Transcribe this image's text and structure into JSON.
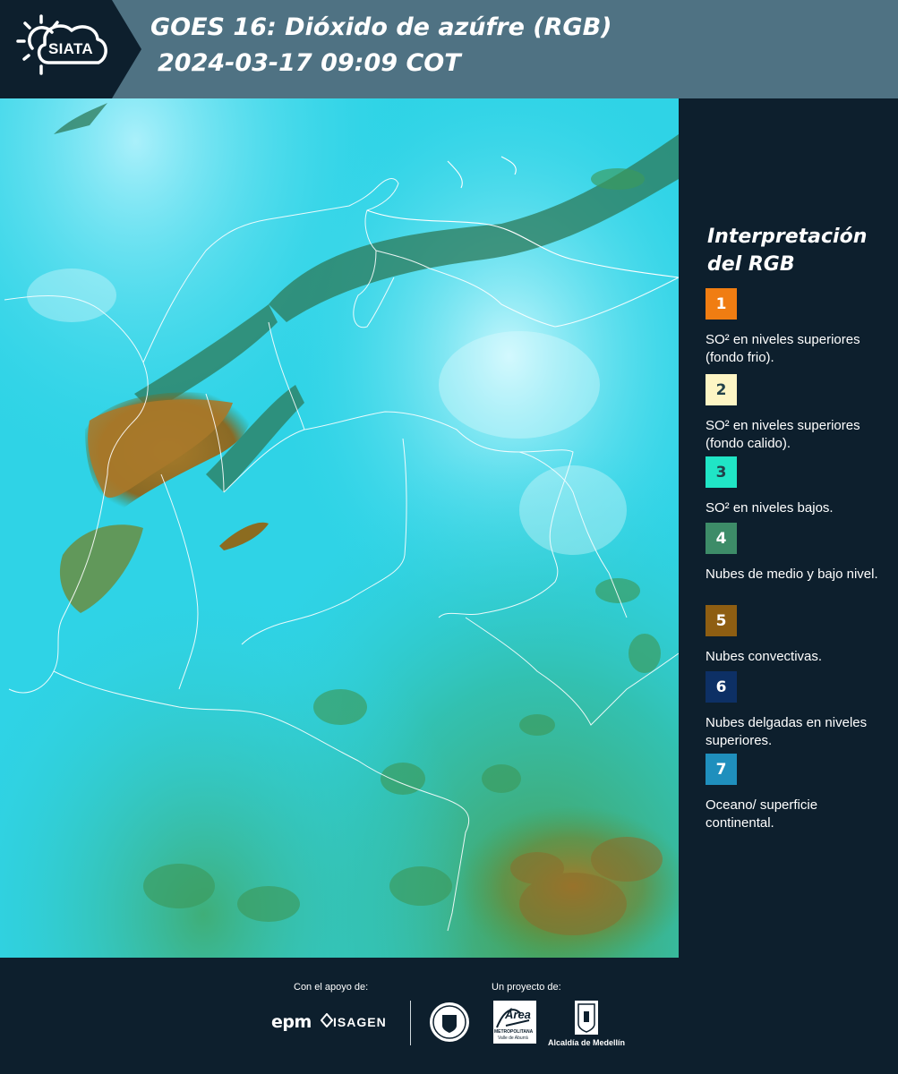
{
  "header": {
    "logo_text": "SIATA",
    "title_line1": "GOES 16: Dióxido de azúfre (RGB)",
    "title_line2": "2024-03-17 09:09 COT"
  },
  "legend": {
    "title": "Interpretación del RGB",
    "items": [
      {
        "number": "1",
        "color": "#f07d12",
        "description": "SO² en niveles superiores (fondo frio)."
      },
      {
        "number": "2",
        "color": "#fdf5c4",
        "description": "SO² en niveles superiores (fondo calido)."
      },
      {
        "number": "3",
        "color": "#20e5c6",
        "description": "SO² en niveles bajos."
      },
      {
        "number": "4",
        "color": "#3d8c68",
        "description": "Nubes de medio y bajo nivel."
      },
      {
        "number": "5",
        "color": "#8e5e12",
        "description": "Nubes convectivas."
      },
      {
        "number": "6",
        "color": "#0d3065",
        "description": "Nubes delgadas en niveles superiores."
      },
      {
        "number": "7",
        "color": "#1f8fbd",
        "description": "Oceano/ superficie continental."
      }
    ]
  },
  "footer": {
    "support_label": "Con el apoyo de:",
    "project_label": "Un proyecto de:",
    "sponsors": [
      "epm",
      "ISAGEN"
    ],
    "area_text_1": "Área",
    "area_text_2": "METROPOLITANA",
    "area_text_3": "Valle de Aburrá",
    "medellin_text": "Alcaldía de Medellín"
  }
}
